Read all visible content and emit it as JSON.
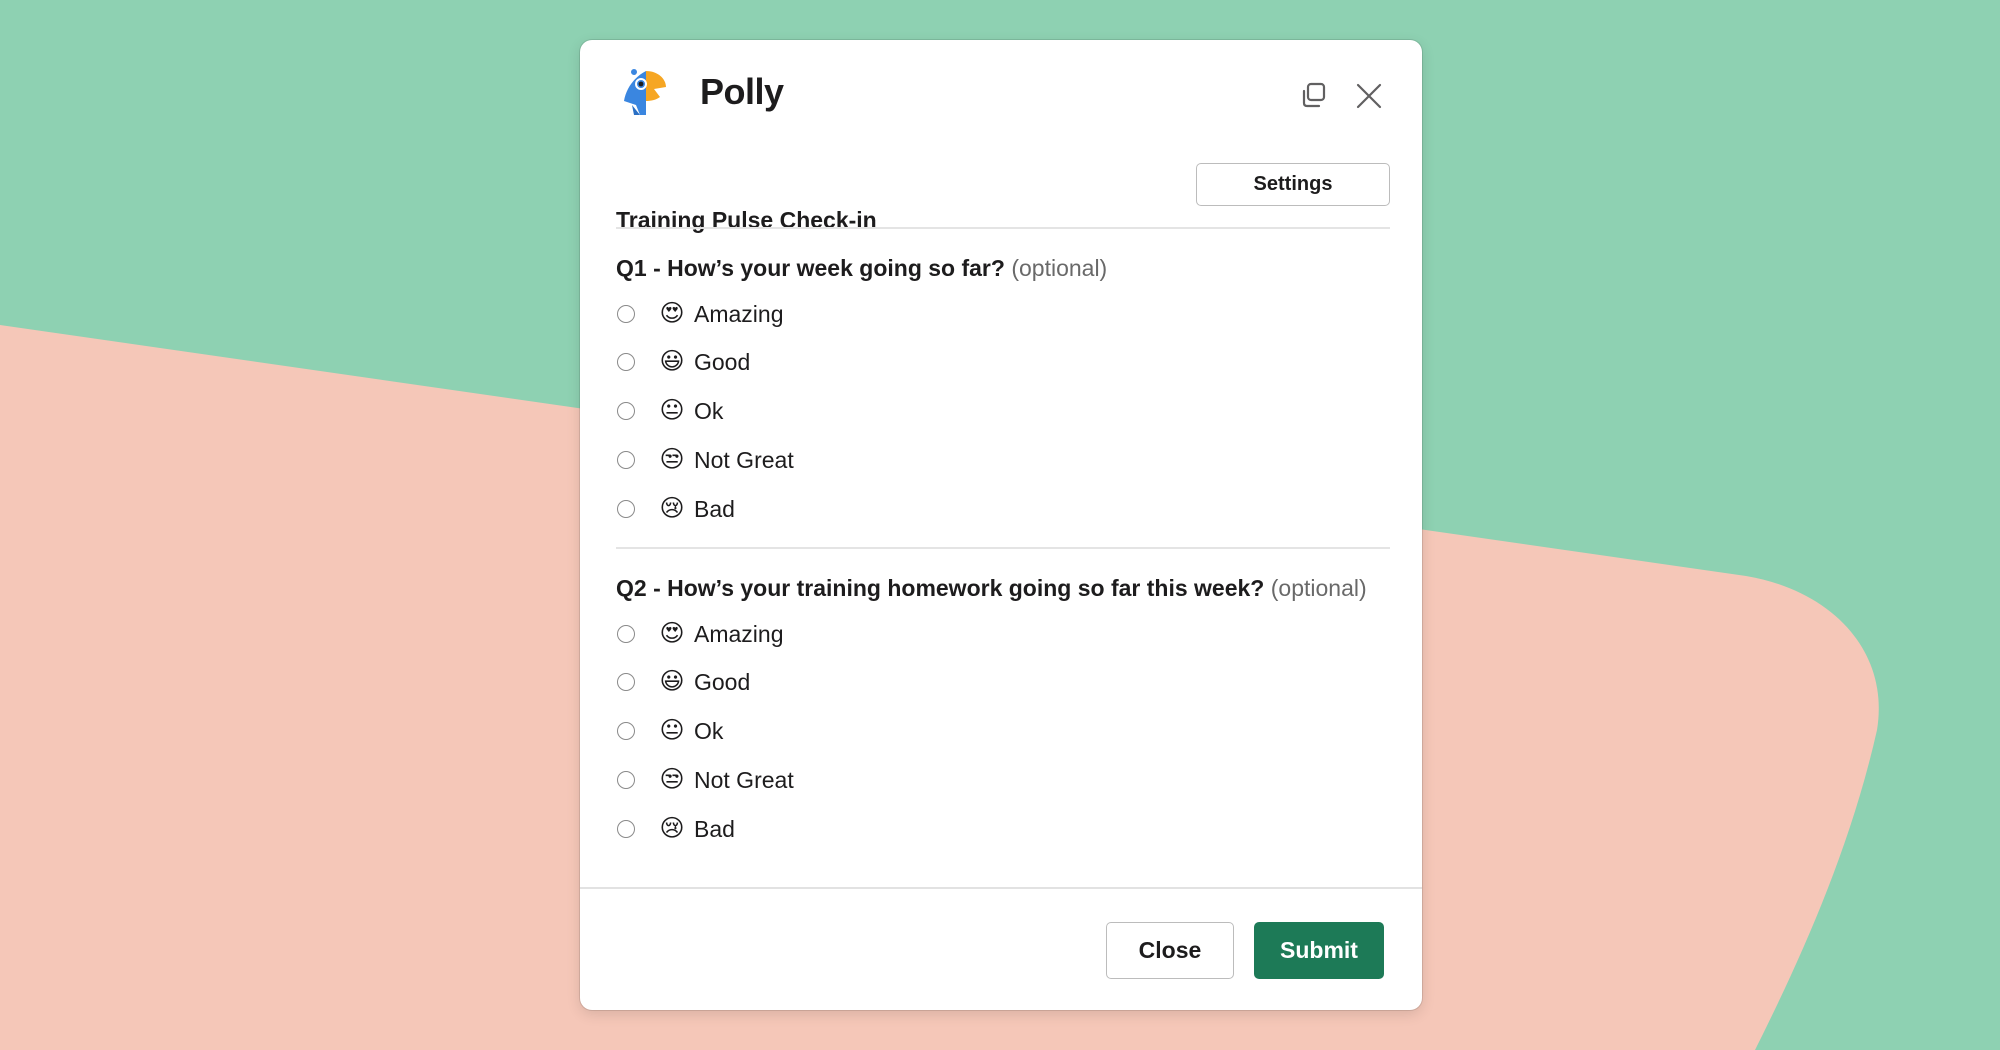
{
  "background": {
    "green": "#8ed1b2",
    "pink": "#f5c7b8"
  },
  "app": {
    "name": "Polly",
    "logo_icon": "polly-parrot-logo"
  },
  "header_icons": {
    "popout": "popout-window-icon",
    "close": "close-icon"
  },
  "survey": {
    "title": "Training Pulse Check-in",
    "settings_label": "Settings"
  },
  "questions": [
    {
      "label": "Q1 - How’s your week going so far?",
      "optional": "(optional)",
      "options": [
        {
          "emoji": "😍",
          "emoji_name": "heart-eyes",
          "label": "Amazing",
          "selected": false
        },
        {
          "emoji": "😃",
          "emoji_name": "smiley",
          "label": "Good",
          "selected": false
        },
        {
          "emoji": "😐",
          "emoji_name": "neutral-face",
          "label": "Ok",
          "selected": false
        },
        {
          "emoji": "😒",
          "emoji_name": "unamused",
          "label": "Not Great",
          "selected": false
        },
        {
          "emoji": "😢",
          "emoji_name": "cry",
          "label": "Bad",
          "selected": false
        }
      ]
    },
    {
      "label": "Q2 - How’s your training homework going so far this week?",
      "optional": "(optional)",
      "options": [
        {
          "emoji": "😍",
          "emoji_name": "heart-eyes",
          "label": "Amazing",
          "selected": false
        },
        {
          "emoji": "😃",
          "emoji_name": "smiley",
          "label": "Good",
          "selected": false
        },
        {
          "emoji": "😐",
          "emoji_name": "neutral-face",
          "label": "Ok",
          "selected": false
        },
        {
          "emoji": "😒",
          "emoji_name": "unamused",
          "label": "Not Great",
          "selected": false
        },
        {
          "emoji": "😢",
          "emoji_name": "cry",
          "label": "Bad",
          "selected": false
        }
      ]
    }
  ],
  "footer": {
    "close_label": "Close",
    "submit_label": "Submit",
    "submit_color": "#1d7a57"
  }
}
